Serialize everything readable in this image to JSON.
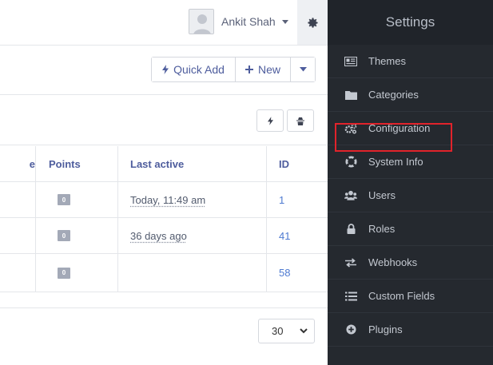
{
  "header": {
    "username": "Ankit Shah"
  },
  "toolbar": {
    "quick_add_label": "Quick Add",
    "new_label": "New"
  },
  "table": {
    "columns": [
      "e",
      "Points",
      "Last active",
      "ID"
    ],
    "rows": [
      {
        "points": "0",
        "last_active": "Today, 11:49 am",
        "id": "1"
      },
      {
        "points": "0",
        "last_active": "36 days ago",
        "id": "41"
      },
      {
        "points": "0",
        "last_active": "",
        "id": "58"
      }
    ]
  },
  "pagination": {
    "per_page_value": "30"
  },
  "sidebar": {
    "title": "Settings",
    "items": [
      {
        "label": "Themes",
        "icon": "newspaper-icon"
      },
      {
        "label": "Categories",
        "icon": "folder-icon"
      },
      {
        "label": "Configuration",
        "icon": "cogs-icon"
      },
      {
        "label": "System Info",
        "icon": "life-ring-icon"
      },
      {
        "label": "Users",
        "icon": "users-icon"
      },
      {
        "label": "Roles",
        "icon": "lock-icon"
      },
      {
        "label": "Webhooks",
        "icon": "exchange-icon"
      },
      {
        "label": "Custom Fields",
        "icon": "list-icon"
      },
      {
        "label": "Plugins",
        "icon": "plus-circle-icon"
      }
    ],
    "highlight_color": "#e1232b",
    "background_color": "#25292f"
  },
  "colors": {
    "accent": "#4e5d9d",
    "link": "#4e7ad1",
    "badge": "#a3a9b7"
  }
}
